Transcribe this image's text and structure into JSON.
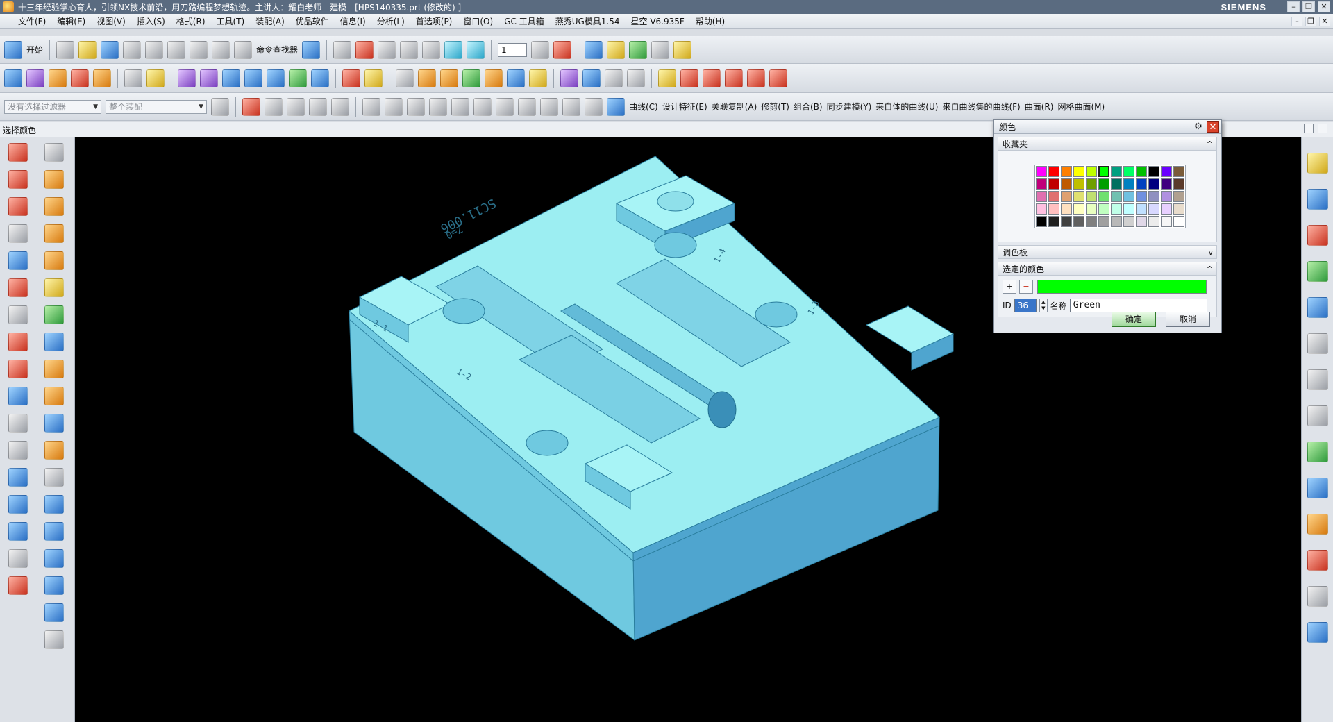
{
  "window": {
    "title": "十三年经验掌心育人，引领NX技术前沿，用刀路编程梦想轨迹。主讲人：耀白老师 - 建模 - [HPS140335.prt  (修改的) ]",
    "brand": "SIEMENS",
    "minimize": "–",
    "restore": "❐",
    "close": "✕"
  },
  "menu": {
    "items": [
      "文件(F)",
      "编辑(E)",
      "视图(V)",
      "插入(S)",
      "格式(R)",
      "工具(T)",
      "装配(A)",
      "优品软件",
      "信息(I)",
      "分析(L)",
      "首选项(P)",
      "窗口(O)",
      "GC 工具箱",
      "燕秀UG模具1.54",
      "星空 V6.935F",
      "帮助(H)"
    ]
  },
  "toolbar1": {
    "start_label": "开始",
    "command_finder": "命令查找器",
    "layer_value": "1"
  },
  "toolbar3": {
    "filter_placeholder": "没有选择过滤器",
    "assembly_scope": "整个装配",
    "menus": [
      "曲线(C)",
      "设计特征(E)",
      "关联复制(A)",
      "修剪(T)",
      "组合(B)",
      "同步建模(Y)",
      "来自体的曲线(U)",
      "来自曲线集的曲线(F)",
      "曲面(R)",
      "网格曲面(M)"
    ]
  },
  "prompt": {
    "text": "选择颜色"
  },
  "model": {
    "engraving_top": "SC11.006",
    "engraving_z": "Z=0",
    "label_1": "1-1",
    "label_2": "1-2",
    "label_3": "1-3",
    "label_4": "1-4"
  },
  "color_dialog": {
    "title": "颜色",
    "gear": "⚙",
    "close": "✕",
    "favorites_label": "收藏夹",
    "palette_label": "调色板",
    "selected_label": "选定的颜色",
    "collapse": "^",
    "expand": "v",
    "id_label": "ID",
    "id_value": "36",
    "name_label": "名称",
    "name_value": "Green",
    "ok_label": "确定",
    "cancel_label": "取消",
    "selected_color": "#00ff00",
    "swatches": [
      [
        "#ff00ff",
        "#ff0000",
        "#ff7f00",
        "#ffff00",
        "#bfff00",
        "#00ff00",
        "#00a080",
        "#00ff66",
        "#00c000",
        "#000000",
        "#6a00ff",
        "#7a5c3a"
      ],
      [
        "#c0007a",
        "#c00000",
        "#c05a00",
        "#bfbf00",
        "#6f9f00",
        "#009f00",
        "#007060",
        "#0080c0",
        "#0040c0",
        "#000080",
        "#400080",
        "#5a3a2a"
      ],
      [
        "#e070b0",
        "#e07070",
        "#e0a070",
        "#e0e070",
        "#c0e070",
        "#70e070",
        "#70c0b0",
        "#70c0e0",
        "#7090e0",
        "#9090c0",
        "#b090e0",
        "#b0a090"
      ],
      [
        "#ffc0e0",
        "#ffc0c0",
        "#ffe0c0",
        "#ffffc0",
        "#e8ffc0",
        "#c0ffc0",
        "#c0ffe8",
        "#c0ffff",
        "#c0e0ff",
        "#d8d8ff",
        "#e8d0ff",
        "#e8dccc"
      ],
      [
        "#000000",
        "#202020",
        "#404040",
        "#606060",
        "#808080",
        "#a0a0a0",
        "#b8b8b8",
        "#d0d0d0",
        "#e0d8e8",
        "#ececec",
        "#f6f6f6",
        "#ffffff"
      ]
    ],
    "selected_swatch": "0-5"
  },
  "colors": {
    "viewport_bg": "#000000",
    "part_top": "#9ceef2",
    "part_left": "#6fc7de",
    "part_right": "#4fa7cf"
  }
}
